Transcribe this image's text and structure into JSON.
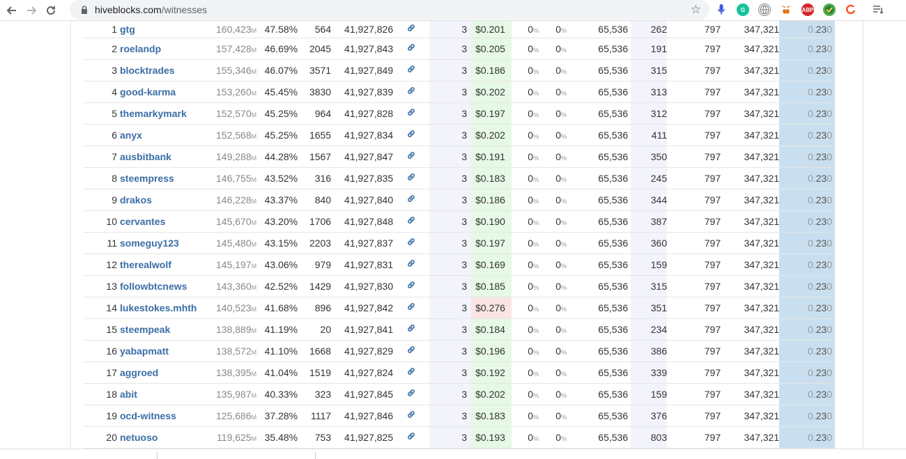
{
  "browser": {
    "url_host": "hiveblocks.com",
    "url_path": "/witnesses",
    "extensions": [
      "microphone-icon",
      "grammarly-icon",
      "globe-icon",
      "metamask-icon",
      "abp-icon",
      "vpn-icon",
      "refresh-ext-icon",
      "reading-list-icon"
    ],
    "abp_label": "ABP"
  },
  "witnesses": [
    {
      "rank": "1",
      "name": "gtg",
      "votes": "160,423",
      "unit": "M",
      "pct": "47.58%",
      "missed": "564",
      "block": "41,927,826",
      "ver": "3",
      "price": "$0.201",
      "price_high": false,
      "rate1": "0",
      "rate2": "0",
      "size": "65,536",
      "txn": "262",
      "b1": "797",
      "b2": "347,321",
      "last_a": "0.",
      "last_b": "23",
      "last_c": "0"
    },
    {
      "rank": "2",
      "name": "roelandp",
      "votes": "157,428",
      "unit": "M",
      "pct": "46.69%",
      "missed": "2045",
      "block": "41,927,843",
      "ver": "3",
      "price": "$0.205",
      "price_high": false,
      "rate1": "0",
      "rate2": "0",
      "size": "65,536",
      "txn": "191",
      "b1": "797",
      "b2": "347,321",
      "last_a": "0.",
      "last_b": "23",
      "last_c": "0"
    },
    {
      "rank": "3",
      "name": "blocktrades",
      "votes": "155,346",
      "unit": "M",
      "pct": "46.07%",
      "missed": "3571",
      "block": "41,927,849",
      "ver": "3",
      "price": "$0.186",
      "price_high": false,
      "rate1": "0",
      "rate2": "0",
      "size": "65,536",
      "txn": "315",
      "b1": "797",
      "b2": "347,321",
      "last_a": "0.",
      "last_b": "23",
      "last_c": "0"
    },
    {
      "rank": "4",
      "name": "good-karma",
      "votes": "153,260",
      "unit": "M",
      "pct": "45.45%",
      "missed": "3830",
      "block": "41,927,839",
      "ver": "3",
      "price": "$0.202",
      "price_high": false,
      "rate1": "0",
      "rate2": "0",
      "size": "65,536",
      "txn": "313",
      "b1": "797",
      "b2": "347,321",
      "last_a": "0.",
      "last_b": "23",
      "last_c": "0"
    },
    {
      "rank": "5",
      "name": "themarkymark",
      "votes": "152,570",
      "unit": "M",
      "pct": "45.25%",
      "missed": "964",
      "block": "41,927,828",
      "ver": "3",
      "price": "$0.197",
      "price_high": false,
      "rate1": "0",
      "rate2": "0",
      "size": "65,536",
      "txn": "312",
      "b1": "797",
      "b2": "347,321",
      "last_a": "0.",
      "last_b": "23",
      "last_c": "0"
    },
    {
      "rank": "6",
      "name": "anyx",
      "votes": "152,568",
      "unit": "M",
      "pct": "45.25%",
      "missed": "1655",
      "block": "41,927,834",
      "ver": "3",
      "price": "$0.202",
      "price_high": false,
      "rate1": "0",
      "rate2": "0",
      "size": "65,536",
      "txn": "411",
      "b1": "797",
      "b2": "347,321",
      "last_a": "0.",
      "last_b": "23",
      "last_c": "0"
    },
    {
      "rank": "7",
      "name": "ausbitbank",
      "votes": "149,288",
      "unit": "M",
      "pct": "44.28%",
      "missed": "1567",
      "block": "41,927,847",
      "ver": "3",
      "price": "$0.191",
      "price_high": false,
      "rate1": "0",
      "rate2": "0",
      "size": "65,536",
      "txn": "350",
      "b1": "797",
      "b2": "347,321",
      "last_a": "0.",
      "last_b": "23",
      "last_c": "0"
    },
    {
      "rank": "8",
      "name": "steempress",
      "votes": "146,755",
      "unit": "M",
      "pct": "43.52%",
      "missed": "316",
      "block": "41,927,835",
      "ver": "3",
      "price": "$0.183",
      "price_high": false,
      "rate1": "0",
      "rate2": "0",
      "size": "65,536",
      "txn": "245",
      "b1": "797",
      "b2": "347,321",
      "last_a": "0.",
      "last_b": "23",
      "last_c": "0"
    },
    {
      "rank": "9",
      "name": "drakos",
      "votes": "146,228",
      "unit": "M",
      "pct": "43.37%",
      "missed": "840",
      "block": "41,927,840",
      "ver": "3",
      "price": "$0.186",
      "price_high": false,
      "rate1": "0",
      "rate2": "0",
      "size": "65,536",
      "txn": "344",
      "b1": "797",
      "b2": "347,321",
      "last_a": "0.",
      "last_b": "23",
      "last_c": "0"
    },
    {
      "rank": "10",
      "name": "cervantes",
      "votes": "145,670",
      "unit": "M",
      "pct": "43.20%",
      "missed": "1706",
      "block": "41,927,848",
      "ver": "3",
      "price": "$0.190",
      "price_high": false,
      "rate1": "0",
      "rate2": "0",
      "size": "65,536",
      "txn": "387",
      "b1": "797",
      "b2": "347,321",
      "last_a": "0.",
      "last_b": "23",
      "last_c": "0"
    },
    {
      "rank": "11",
      "name": "someguy123",
      "votes": "145,480",
      "unit": "M",
      "pct": "43.15%",
      "missed": "2203",
      "block": "41,927,837",
      "ver": "3",
      "price": "$0.197",
      "price_high": false,
      "rate1": "0",
      "rate2": "0",
      "size": "65,536",
      "txn": "360",
      "b1": "797",
      "b2": "347,321",
      "last_a": "0.",
      "last_b": "23",
      "last_c": "0"
    },
    {
      "rank": "12",
      "name": "therealwolf",
      "votes": "145,197",
      "unit": "M",
      "pct": "43.06%",
      "missed": "979",
      "block": "41,927,831",
      "ver": "3",
      "price": "$0.169",
      "price_high": false,
      "rate1": "0",
      "rate2": "0",
      "size": "65,536",
      "txn": "159",
      "b1": "797",
      "b2": "347,321",
      "last_a": "0.",
      "last_b": "23",
      "last_c": "0"
    },
    {
      "rank": "13",
      "name": "followbtcnews",
      "votes": "143,360",
      "unit": "M",
      "pct": "42.52%",
      "missed": "1429",
      "block": "41,927,830",
      "ver": "3",
      "price": "$0.185",
      "price_high": false,
      "rate1": "0",
      "rate2": "0",
      "size": "65,536",
      "txn": "315",
      "b1": "797",
      "b2": "347,321",
      "last_a": "0.",
      "last_b": "23",
      "last_c": "0"
    },
    {
      "rank": "14",
      "name": "lukestokes.mhth",
      "votes": "140,523",
      "unit": "M",
      "pct": "41.68%",
      "missed": "896",
      "block": "41,927,842",
      "ver": "3",
      "price": "$0.276",
      "price_high": true,
      "rate1": "0",
      "rate2": "0",
      "size": "65,536",
      "txn": "351",
      "b1": "797",
      "b2": "347,321",
      "last_a": "0.",
      "last_b": "23",
      "last_c": "0"
    },
    {
      "rank": "15",
      "name": "steempeak",
      "votes": "138,889",
      "unit": "M",
      "pct": "41.19%",
      "missed": "20",
      "block": "41,927,841",
      "ver": "3",
      "price": "$0.184",
      "price_high": false,
      "rate1": "0",
      "rate2": "0",
      "size": "65,536",
      "txn": "234",
      "b1": "797",
      "b2": "347,321",
      "last_a": "0.",
      "last_b": "23",
      "last_c": "0"
    },
    {
      "rank": "16",
      "name": "yabapmatt",
      "votes": "138,572",
      "unit": "M",
      "pct": "41.10%",
      "missed": "1668",
      "block": "41,927,829",
      "ver": "3",
      "price": "$0.196",
      "price_high": false,
      "rate1": "0",
      "rate2": "0",
      "size": "65,536",
      "txn": "386",
      "b1": "797",
      "b2": "347,321",
      "last_a": "0.",
      "last_b": "23",
      "last_c": "0"
    },
    {
      "rank": "17",
      "name": "aggroed",
      "votes": "138,395",
      "unit": "M",
      "pct": "41.04%",
      "missed": "1519",
      "block": "41,927,824",
      "ver": "3",
      "price": "$0.192",
      "price_high": false,
      "rate1": "0",
      "rate2": "0",
      "size": "65,536",
      "txn": "339",
      "b1": "797",
      "b2": "347,321",
      "last_a": "0.",
      "last_b": "23",
      "last_c": "0"
    },
    {
      "rank": "18",
      "name": "abit",
      "votes": "135,987",
      "unit": "M",
      "pct": "40.33%",
      "missed": "323",
      "block": "41,927,845",
      "ver": "3",
      "price": "$0.202",
      "price_high": false,
      "rate1": "0",
      "rate2": "0",
      "size": "65,536",
      "txn": "159",
      "b1": "797",
      "b2": "347,321",
      "last_a": "0.",
      "last_b": "23",
      "last_c": "0"
    },
    {
      "rank": "19",
      "name": "ocd-witness",
      "votes": "125,686",
      "unit": "M",
      "pct": "37.28%",
      "missed": "1117",
      "block": "41,927,846",
      "ver": "3",
      "price": "$0.183",
      "price_high": false,
      "rate1": "0",
      "rate2": "0",
      "size": "65,536",
      "txn": "376",
      "b1": "797",
      "b2": "347,321",
      "last_a": "0.",
      "last_b": "23",
      "last_c": "0"
    },
    {
      "rank": "20",
      "name": "netuoso",
      "votes": "119,625",
      "unit": "M",
      "pct": "35.48%",
      "missed": "753",
      "block": "41,927,825",
      "ver": "3",
      "price": "$0.193",
      "price_high": false,
      "rate1": "0",
      "rate2": "0",
      "size": "65,536",
      "txn": "803",
      "b1": "797",
      "b2": "347,321",
      "last_a": "0.",
      "last_b": "23",
      "last_c": "0"
    }
  ],
  "percent_symbol": "%"
}
